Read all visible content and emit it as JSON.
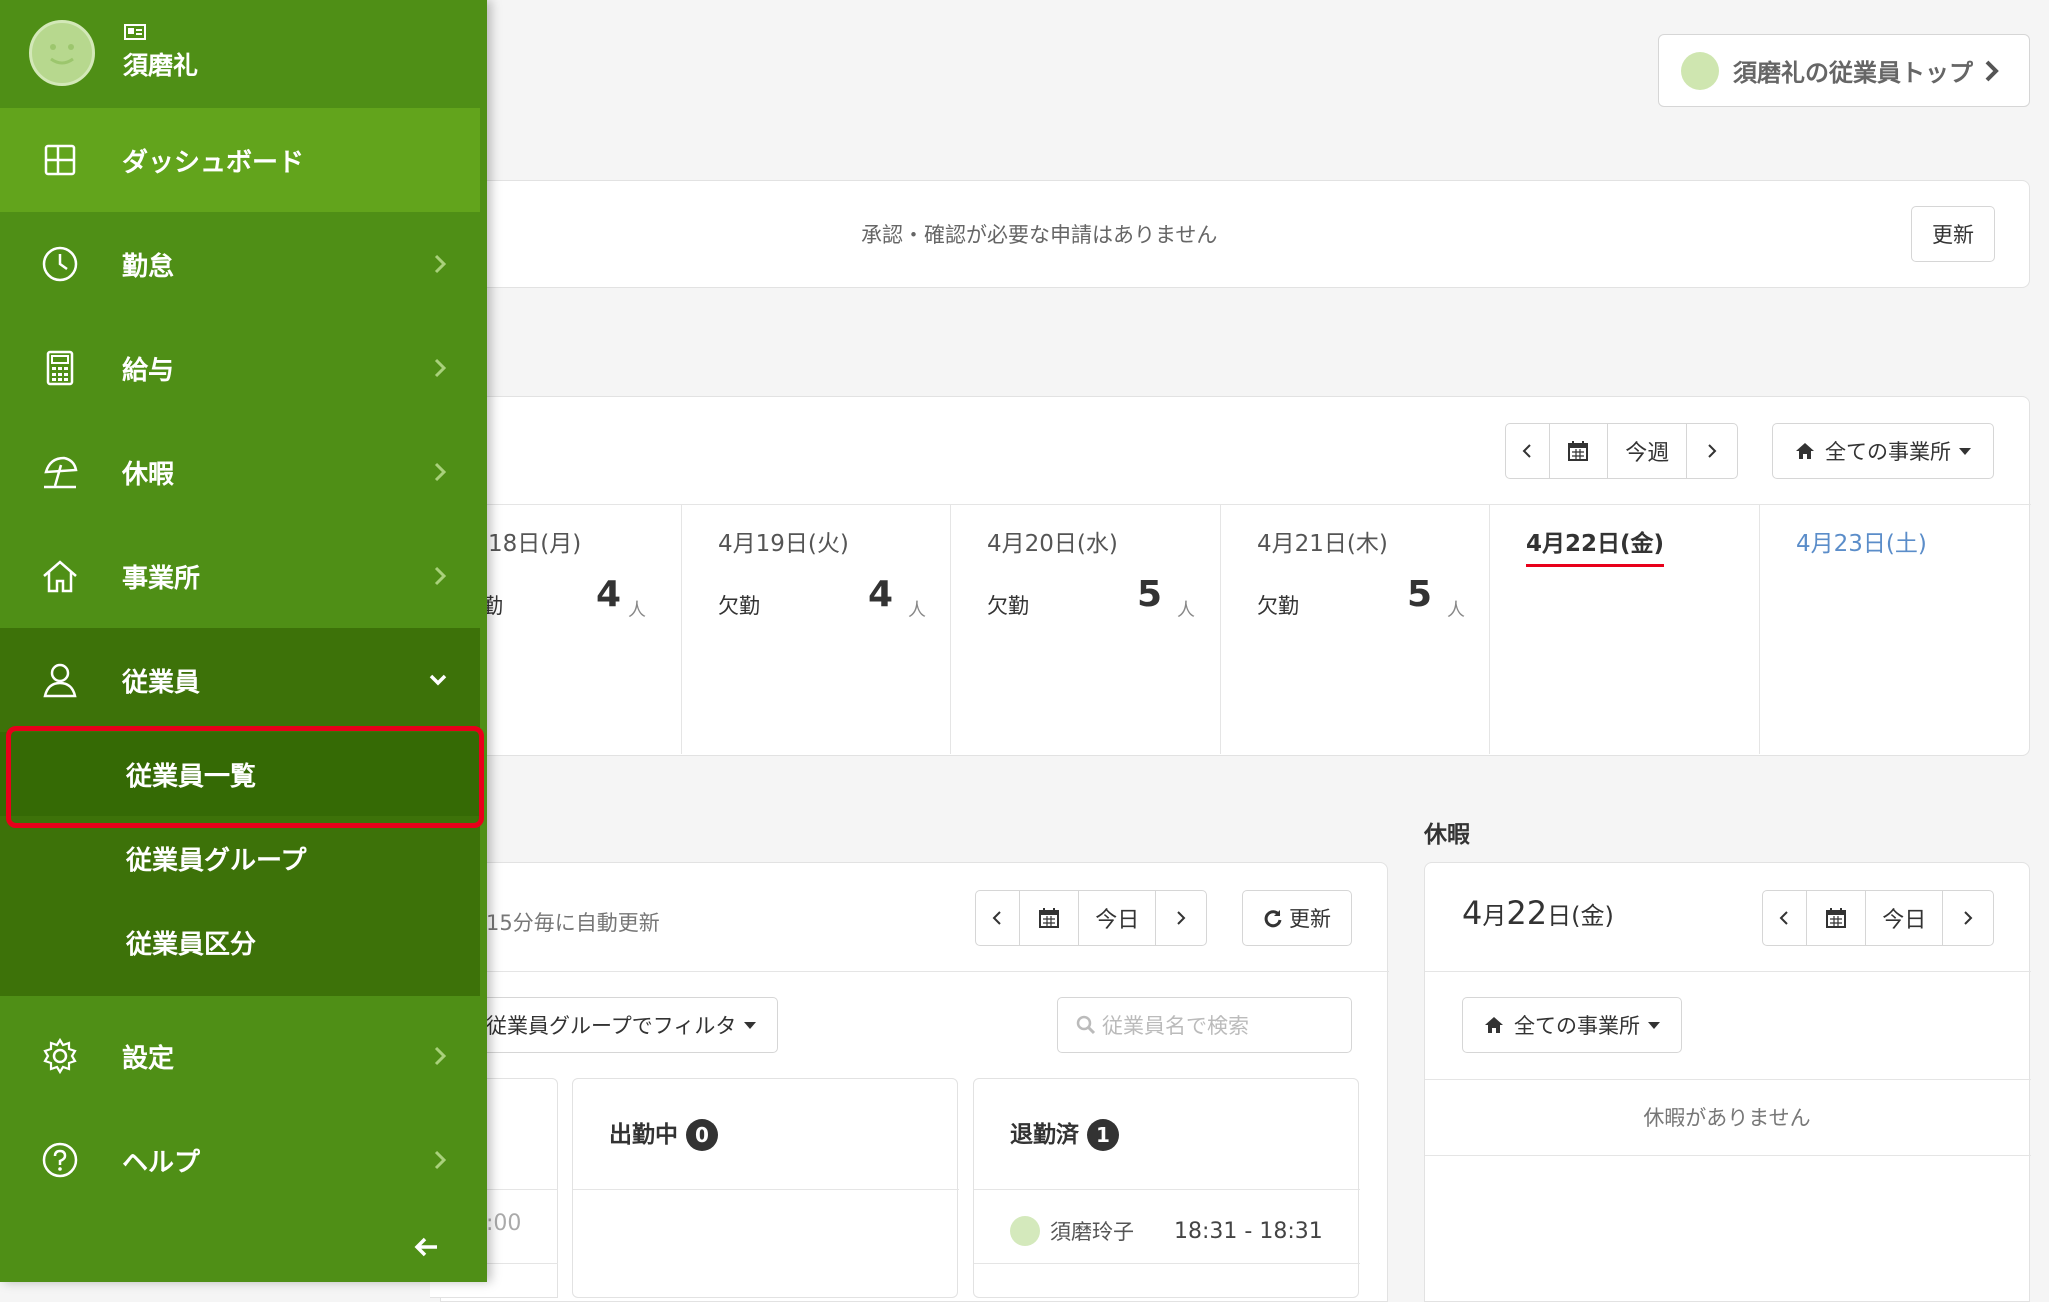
{
  "user": {
    "name": "須磨礼",
    "top_link": "須磨礼の従業員トップ"
  },
  "approvals": {
    "message": "承認・確認が必要な申請はありません",
    "refresh": "更新"
  },
  "schedule": {
    "this_week": "今週",
    "office_filter": "全ての事業所",
    "days": [
      {
        "date": "18日(月)",
        "kind": "勤",
        "count": "4",
        "unit": "人"
      },
      {
        "date": "4月19日(火)",
        "kind": "欠勤",
        "count": "4",
        "unit": "人"
      },
      {
        "date": "4月20日(水)",
        "kind": "欠勤",
        "count": "5",
        "unit": "人"
      },
      {
        "date": "4月21日(木)",
        "kind": "欠勤",
        "count": "5",
        "unit": "人"
      },
      {
        "date": "4月22日(金)"
      },
      {
        "date": "4月23日(土)"
      }
    ]
  },
  "attendance": {
    "auto_refresh": "15分毎に自動更新",
    "today": "今日",
    "refresh": "更新",
    "group_filter": "従業員グループでフィルタ",
    "search_placeholder": "従業員名で検索",
    "col_left_time": ":00",
    "working": {
      "label": "出勤中",
      "count": "0"
    },
    "left": {
      "label": "退勤済",
      "count": "1",
      "rows": [
        {
          "name": "須磨玲子",
          "time": "18:31 - 18:31"
        }
      ]
    }
  },
  "leave": {
    "heading": "休暇",
    "date_month": "4",
    "date_month_unit": "月",
    "date_day": "22",
    "date_day_unit": "日(金)",
    "today": "今日",
    "office_filter": "全ての事業所",
    "empty": "休暇がありません"
  },
  "sidebar": {
    "items": [
      {
        "label": "ダッシュボード",
        "icon": "dashboard-icon"
      },
      {
        "label": "勤怠",
        "icon": "clock-icon"
      },
      {
        "label": "給与",
        "icon": "calculator-icon"
      },
      {
        "label": "休暇",
        "icon": "beach-umbrella-icon"
      },
      {
        "label": "事業所",
        "icon": "home-icon"
      },
      {
        "label": "従業員",
        "icon": "person-icon"
      },
      {
        "label": "設定",
        "icon": "gear-icon"
      },
      {
        "label": "ヘルプ",
        "icon": "help-icon"
      }
    ],
    "subitems": [
      {
        "label": "従業員一覧"
      },
      {
        "label": "従業員グループ"
      },
      {
        "label": "従業員区分"
      }
    ]
  },
  "colors": {
    "sidebar": "#4f8f16",
    "sidebar_active": "#62a41c",
    "sidebar_dark": "#3d7209",
    "sub_selected": "#356a05",
    "highlight_border": "#e8001a",
    "today_underline": "#e8001a",
    "saturday": "#5b8dc9"
  }
}
